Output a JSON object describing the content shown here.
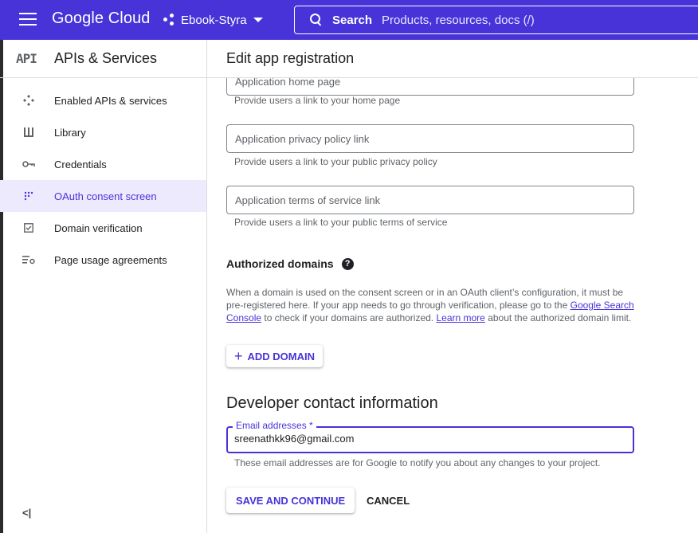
{
  "header": {
    "logo": "Google Cloud",
    "project": "Ebook-Styra",
    "search_label": "Search",
    "search_placeholder": "Products, resources, docs (/)"
  },
  "sidebar": {
    "api_badge": "API",
    "title": "APIs & Services",
    "items": [
      {
        "label": "Enabled APIs & services",
        "icon": "apis-icon",
        "active": false
      },
      {
        "label": "Library",
        "icon": "library-icon",
        "active": false
      },
      {
        "label": "Credentials",
        "icon": "key-icon",
        "active": false
      },
      {
        "label": "OAuth consent screen",
        "icon": "consent-icon",
        "active": true
      },
      {
        "label": "Domain verification",
        "icon": "checkbox-icon",
        "active": false
      },
      {
        "label": "Page usage agreements",
        "icon": "settings-list-icon",
        "active": false
      }
    ],
    "collapse_label": "<|"
  },
  "main": {
    "title": "Edit app registration",
    "home_page": {
      "placeholder": "Application home page",
      "hint": "Provide users a link to your home page"
    },
    "privacy": {
      "placeholder": "Application privacy policy link",
      "hint": "Provide users a link to your public privacy policy"
    },
    "terms": {
      "placeholder": "Application terms of service link",
      "hint": "Provide users a link to your public terms of service"
    },
    "authorized_domains": {
      "title": "Authorized domains",
      "help": "?",
      "text1": "When a domain is used on the consent screen or in an OAuth client’s configuration, it must be pre-registered here. If your app needs to go through verification, please go to the ",
      "link1": "Google Search Console",
      "text2": " to check if your domains are authorized. ",
      "link2": "Learn more",
      "text3": " about the authorized domain limit.",
      "add_button": "ADD DOMAIN",
      "add_icon": "+"
    },
    "developer": {
      "title": "Developer contact information",
      "email_label": "Email addresses *",
      "email_value": "sreenathkk96@gmail.com",
      "hint": "These email addresses are for Google to notify you about any changes to your project."
    },
    "buttons": {
      "save": "SAVE AND CONTINUE",
      "cancel": "CANCEL"
    }
  },
  "colors": {
    "accent": "#4733d8",
    "active_bg": "#eeeafe"
  }
}
